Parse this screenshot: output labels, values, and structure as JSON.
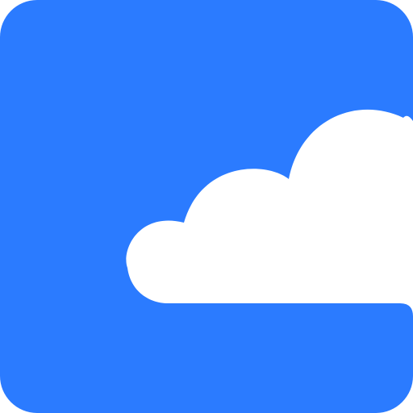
{
  "icon": {
    "name": "cloud-app-icon",
    "glyph": "cloud-icon",
    "colors": {
      "background": "#2B7BFF",
      "cloud": "#FFFFFF"
    }
  }
}
